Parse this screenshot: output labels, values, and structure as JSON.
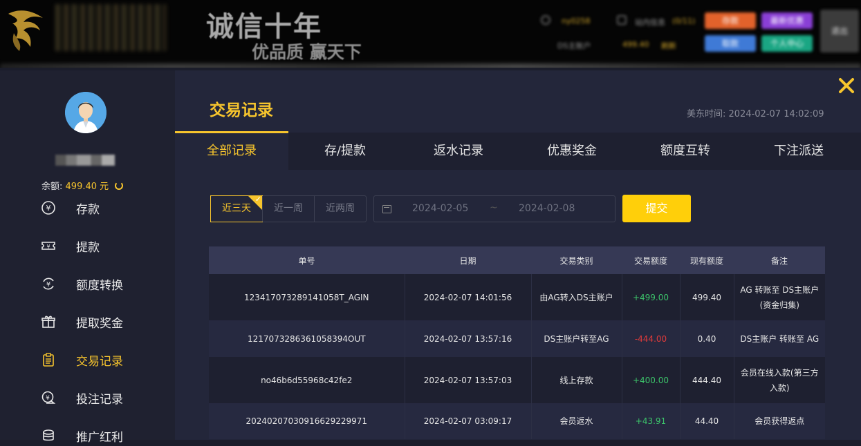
{
  "header": {
    "slogan_line1": "诚信十年",
    "slogan_line2": "优品质  赢天下",
    "username": "ny0258",
    "messages_label": "站内信息",
    "messages_count": "(0/11)",
    "account_label": "DS主账户",
    "account_balance": "499.40",
    "refresh_label": "刷新",
    "buttons": {
      "deposit": "存款",
      "promo": "最新优惠",
      "withdraw": "取款",
      "profile": "个人中心",
      "logout": "退出"
    },
    "colors": {
      "deposit": "#e2622b",
      "promo": "#8a3fd6",
      "withdraw": "#3f7ad6",
      "profile": "#1aa683"
    }
  },
  "sidebar": {
    "balance_label": "余额:",
    "balance_value": "499.40 元",
    "items": [
      {
        "label": "存款",
        "icon": "yuan-circle-icon"
      },
      {
        "label": "提款",
        "icon": "ticket-icon"
      },
      {
        "label": "额度转换",
        "icon": "exchange-yuan-icon"
      },
      {
        "label": "提取奖金",
        "icon": "gift-icon"
      },
      {
        "label": "交易记录",
        "icon": "clipboard-icon",
        "active": true
      },
      {
        "label": "投注记录",
        "icon": "bet-record-icon"
      },
      {
        "label": "推广红利",
        "icon": "coin-stack-icon"
      }
    ]
  },
  "main": {
    "title": "交易记录",
    "server_time": "美东时间: 2024-02-07 14:02:09",
    "tabs": [
      "全部记录",
      "存/提款",
      "返水记录",
      "优惠奖金",
      "额度互转",
      "下注派送"
    ],
    "active_tab": 0
  },
  "filter": {
    "ranges": [
      "近三天",
      "近一周",
      "近两周"
    ],
    "active_range": 0,
    "date_from": "2024-02-05",
    "date_separator": "~",
    "date_to": "2024-02-08",
    "submit_label": "提交"
  },
  "table": {
    "columns": [
      "单号",
      "日期",
      "交易类别",
      "交易额度",
      "现有额度",
      "备注"
    ],
    "rows": [
      [
        "123417073289141058T_AGIN",
        "2024-02-07 14:01:56",
        "由AG转入DS主账户",
        "+499.00",
        "499.40",
        "AG 转账至 DS主账户(资金归集)"
      ],
      [
        "121707328636105839​4OUT",
        "2024-02-07 13:57:16",
        "DS主账户转至AG",
        "-444.00",
        "0.40",
        "DS主账户 转账至 AG"
      ],
      [
        "no46b6d55968c42fe2",
        "2024-02-07 13:57:03",
        "线上存款",
        "+400.00",
        "444.40",
        "会员在线入款(第三方入款)"
      ],
      [
        "20240207030916629229971",
        "2024-02-07 03:09:17",
        "会员返水",
        "+43.91",
        "44.40",
        "会员获得返点"
      ]
    ]
  }
}
